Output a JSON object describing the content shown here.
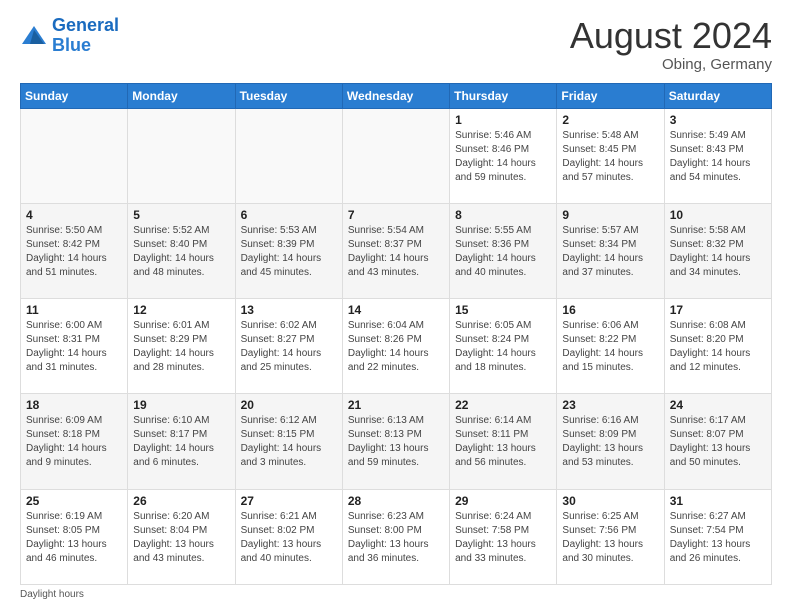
{
  "header": {
    "logo_line1": "General",
    "logo_line2": "Blue",
    "month_year": "August 2024",
    "location": "Obing, Germany"
  },
  "days_of_week": [
    "Sunday",
    "Monday",
    "Tuesday",
    "Wednesday",
    "Thursday",
    "Friday",
    "Saturday"
  ],
  "weeks": [
    [
      {
        "day": "",
        "info": ""
      },
      {
        "day": "",
        "info": ""
      },
      {
        "day": "",
        "info": ""
      },
      {
        "day": "",
        "info": ""
      },
      {
        "day": "1",
        "info": "Sunrise: 5:46 AM\nSunset: 8:46 PM\nDaylight: 14 hours\nand 59 minutes."
      },
      {
        "day": "2",
        "info": "Sunrise: 5:48 AM\nSunset: 8:45 PM\nDaylight: 14 hours\nand 57 minutes."
      },
      {
        "day": "3",
        "info": "Sunrise: 5:49 AM\nSunset: 8:43 PM\nDaylight: 14 hours\nand 54 minutes."
      }
    ],
    [
      {
        "day": "4",
        "info": "Sunrise: 5:50 AM\nSunset: 8:42 PM\nDaylight: 14 hours\nand 51 minutes."
      },
      {
        "day": "5",
        "info": "Sunrise: 5:52 AM\nSunset: 8:40 PM\nDaylight: 14 hours\nand 48 minutes."
      },
      {
        "day": "6",
        "info": "Sunrise: 5:53 AM\nSunset: 8:39 PM\nDaylight: 14 hours\nand 45 minutes."
      },
      {
        "day": "7",
        "info": "Sunrise: 5:54 AM\nSunset: 8:37 PM\nDaylight: 14 hours\nand 43 minutes."
      },
      {
        "day": "8",
        "info": "Sunrise: 5:55 AM\nSunset: 8:36 PM\nDaylight: 14 hours\nand 40 minutes."
      },
      {
        "day": "9",
        "info": "Sunrise: 5:57 AM\nSunset: 8:34 PM\nDaylight: 14 hours\nand 37 minutes."
      },
      {
        "day": "10",
        "info": "Sunrise: 5:58 AM\nSunset: 8:32 PM\nDaylight: 14 hours\nand 34 minutes."
      }
    ],
    [
      {
        "day": "11",
        "info": "Sunrise: 6:00 AM\nSunset: 8:31 PM\nDaylight: 14 hours\nand 31 minutes."
      },
      {
        "day": "12",
        "info": "Sunrise: 6:01 AM\nSunset: 8:29 PM\nDaylight: 14 hours\nand 28 minutes."
      },
      {
        "day": "13",
        "info": "Sunrise: 6:02 AM\nSunset: 8:27 PM\nDaylight: 14 hours\nand 25 minutes."
      },
      {
        "day": "14",
        "info": "Sunrise: 6:04 AM\nSunset: 8:26 PM\nDaylight: 14 hours\nand 22 minutes."
      },
      {
        "day": "15",
        "info": "Sunrise: 6:05 AM\nSunset: 8:24 PM\nDaylight: 14 hours\nand 18 minutes."
      },
      {
        "day": "16",
        "info": "Sunrise: 6:06 AM\nSunset: 8:22 PM\nDaylight: 14 hours\nand 15 minutes."
      },
      {
        "day": "17",
        "info": "Sunrise: 6:08 AM\nSunset: 8:20 PM\nDaylight: 14 hours\nand 12 minutes."
      }
    ],
    [
      {
        "day": "18",
        "info": "Sunrise: 6:09 AM\nSunset: 8:18 PM\nDaylight: 14 hours\nand 9 minutes."
      },
      {
        "day": "19",
        "info": "Sunrise: 6:10 AM\nSunset: 8:17 PM\nDaylight: 14 hours\nand 6 minutes."
      },
      {
        "day": "20",
        "info": "Sunrise: 6:12 AM\nSunset: 8:15 PM\nDaylight: 14 hours\nand 3 minutes."
      },
      {
        "day": "21",
        "info": "Sunrise: 6:13 AM\nSunset: 8:13 PM\nDaylight: 13 hours\nand 59 minutes."
      },
      {
        "day": "22",
        "info": "Sunrise: 6:14 AM\nSunset: 8:11 PM\nDaylight: 13 hours\nand 56 minutes."
      },
      {
        "day": "23",
        "info": "Sunrise: 6:16 AM\nSunset: 8:09 PM\nDaylight: 13 hours\nand 53 minutes."
      },
      {
        "day": "24",
        "info": "Sunrise: 6:17 AM\nSunset: 8:07 PM\nDaylight: 13 hours\nand 50 minutes."
      }
    ],
    [
      {
        "day": "25",
        "info": "Sunrise: 6:19 AM\nSunset: 8:05 PM\nDaylight: 13 hours\nand 46 minutes."
      },
      {
        "day": "26",
        "info": "Sunrise: 6:20 AM\nSunset: 8:04 PM\nDaylight: 13 hours\nand 43 minutes."
      },
      {
        "day": "27",
        "info": "Sunrise: 6:21 AM\nSunset: 8:02 PM\nDaylight: 13 hours\nand 40 minutes."
      },
      {
        "day": "28",
        "info": "Sunrise: 6:23 AM\nSunset: 8:00 PM\nDaylight: 13 hours\nand 36 minutes."
      },
      {
        "day": "29",
        "info": "Sunrise: 6:24 AM\nSunset: 7:58 PM\nDaylight: 13 hours\nand 33 minutes."
      },
      {
        "day": "30",
        "info": "Sunrise: 6:25 AM\nSunset: 7:56 PM\nDaylight: 13 hours\nand 30 minutes."
      },
      {
        "day": "31",
        "info": "Sunrise: 6:27 AM\nSunset: 7:54 PM\nDaylight: 13 hours\nand 26 minutes."
      }
    ]
  ],
  "footer": "Daylight hours"
}
